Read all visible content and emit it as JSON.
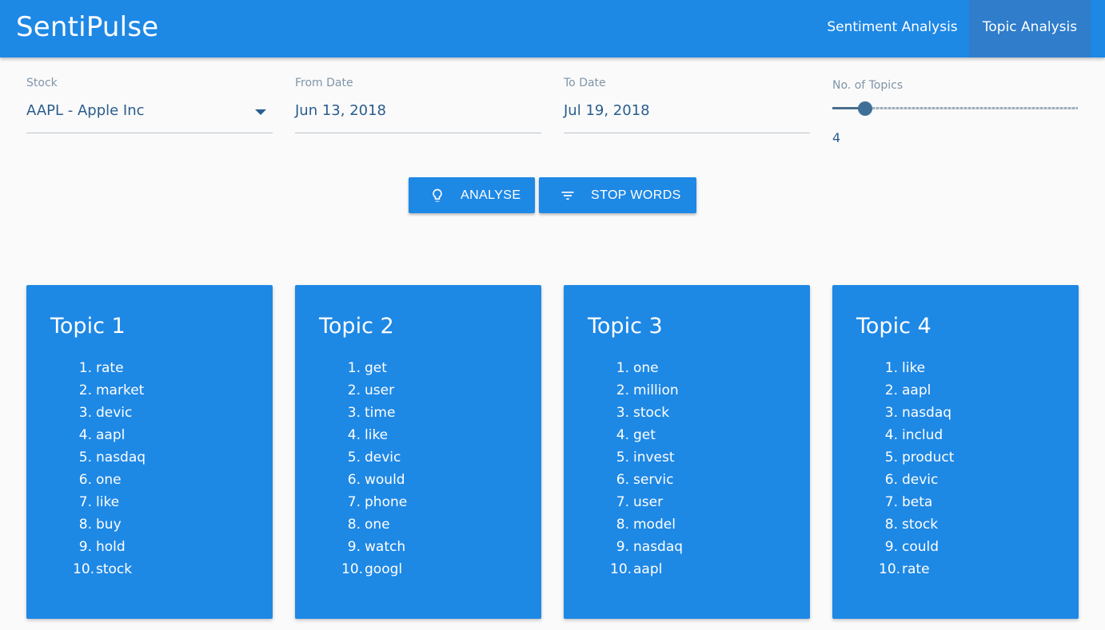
{
  "app": {
    "brand": "SentiPulse",
    "tabs": [
      {
        "label": "Sentiment Analysis",
        "active": false
      },
      {
        "label": "Topic Analysis",
        "active": true
      }
    ]
  },
  "filters": {
    "stock": {
      "label": "Stock",
      "value": "AAPL - Apple Inc"
    },
    "from_date": {
      "label": "From Date",
      "value": "Jun 13, 2018"
    },
    "to_date": {
      "label": "To Date",
      "value": "Jul 19, 2018"
    },
    "topics": {
      "label": "No. of Topics",
      "value": "4",
      "fraction": 0.135
    }
  },
  "actions": {
    "analyse": {
      "label": "ANALYSE",
      "icon": "lightbulb-icon"
    },
    "stop_words": {
      "label": "STOP WORDS",
      "icon": "filter-list-icon"
    }
  },
  "topics": [
    {
      "title": "Topic 1",
      "words": [
        "rate",
        "market",
        "devic",
        "aapl",
        "nasdaq",
        "one",
        "like",
        "buy",
        "hold",
        "stock"
      ]
    },
    {
      "title": "Topic 2",
      "words": [
        "get",
        "user",
        "time",
        "like",
        "devic",
        "would",
        "phone",
        "one",
        "watch",
        "googl"
      ]
    },
    {
      "title": "Topic 3",
      "words": [
        "one",
        "million",
        "stock",
        "get",
        "invest",
        "servic",
        "user",
        "model",
        "nasdaq",
        "aapl"
      ]
    },
    {
      "title": "Topic 4",
      "words": [
        "like",
        "aapl",
        "nasdaq",
        "includ",
        "product",
        "devic",
        "beta",
        "stock",
        "could",
        "rate"
      ]
    }
  ],
  "colors": {
    "primary": "#1e88e5",
    "active_tab": "#2f7dcb",
    "text": "#2a5d8d"
  }
}
